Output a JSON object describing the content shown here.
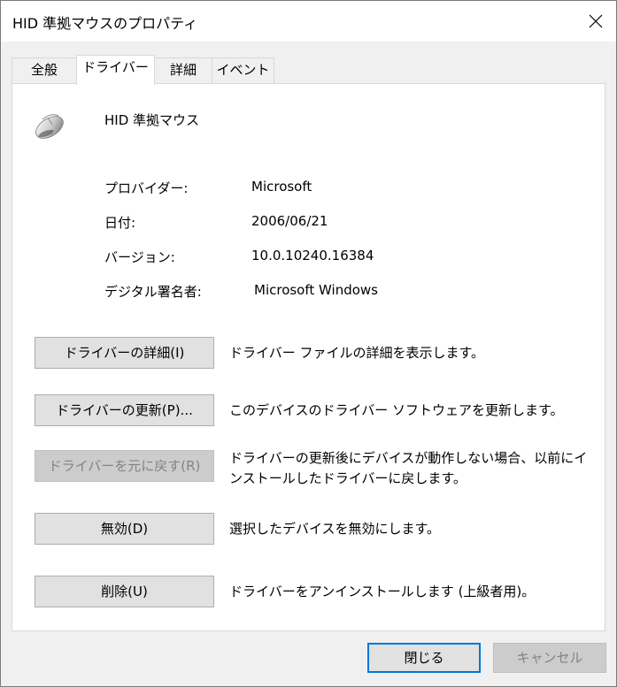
{
  "window": {
    "title": "HID 準拠マウスのプロパティ",
    "close_glyph": "✕"
  },
  "tabs": [
    {
      "label": "全般"
    },
    {
      "label": "ドライバー"
    },
    {
      "label": "詳細"
    },
    {
      "label": "イベント"
    }
  ],
  "device": {
    "icon": "mouse-icon",
    "name": "HID 準拠マウス"
  },
  "properties": {
    "provider": {
      "label": "プロバイダー:",
      "value": "Microsoft"
    },
    "date": {
      "label": "日付:",
      "value": "2006/06/21"
    },
    "version": {
      "label": "バージョン:",
      "value": "10.0.10240.16384"
    },
    "signer": {
      "label": "デジタル署名者:",
      "value": "Microsoft Windows"
    }
  },
  "actions": {
    "details": {
      "label": "ドライバーの詳細(I)",
      "description": "ドライバー ファイルの詳細を表示します。"
    },
    "update": {
      "label": "ドライバーの更新(P)...",
      "description": "このデバイスのドライバー ソフトウェアを更新します。"
    },
    "rollback": {
      "label": "ドライバーを元に戻す(R)",
      "description": "ドライバーの更新後にデバイスが動作しない場合、以前にインストールしたドライバーに戻します。"
    },
    "disable": {
      "label": "無効(D)",
      "description": "選択したデバイスを無効にします。"
    },
    "uninstall": {
      "label": "削除(U)",
      "description": "ドライバーをアンインストールします (上級者用)。"
    }
  },
  "footer": {
    "close_label": "閉じる",
    "cancel_label": "キャンセル"
  },
  "colors": {
    "accent": "#0078d7",
    "disabled_text": "#838383"
  }
}
